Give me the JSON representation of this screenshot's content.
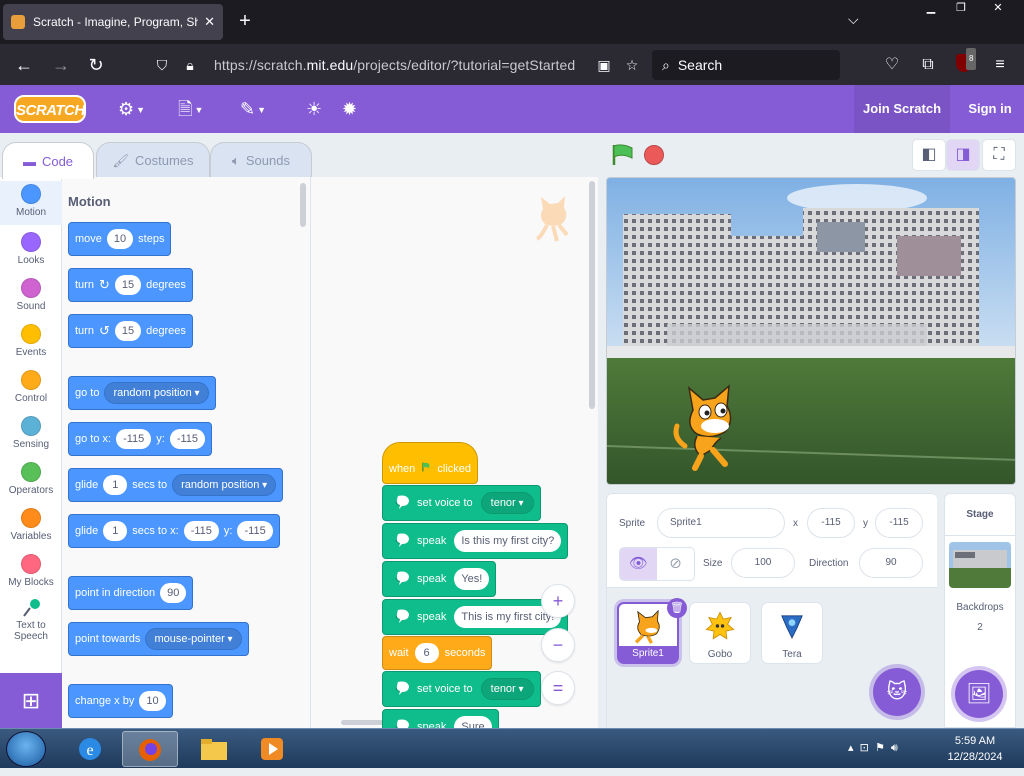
{
  "browser": {
    "tab_title": "Scratch - Imagine, Program, Sh",
    "new_tab": "+",
    "url_prefix": "https://scratch.",
    "url_host": "mit.edu",
    "url_rest": "/projects/editor/?tutorial=getStarted",
    "search_placeholder": "Search",
    "ublock_count": "8"
  },
  "menubar": {
    "logo": "SCRATCH",
    "join": "Join Scratch",
    "signin": "Sign in"
  },
  "editor_tabs": {
    "code": "Code",
    "costumes": "Costumes",
    "sounds": "Sounds"
  },
  "categories": [
    {
      "label": "Motion",
      "color": "#4c97ff"
    },
    {
      "label": "Looks",
      "color": "#9966ff"
    },
    {
      "label": "Sound",
      "color": "#cf63cf"
    },
    {
      "label": "Events",
      "color": "#ffbf00"
    },
    {
      "label": "Control",
      "color": "#ffab19"
    },
    {
      "label": "Sensing",
      "color": "#5cb1d6"
    },
    {
      "label": "Operators",
      "color": "#59c059"
    },
    {
      "label": "Variables",
      "color": "#ff8c1a"
    },
    {
      "label": "My Blocks",
      "color": "#ff6680"
    },
    {
      "label1": "Text to",
      "label2": "Speech",
      "color": "#0fbd8c"
    }
  ],
  "palette": {
    "title": "Motion",
    "move": {
      "a": "move",
      "n": "10",
      "b": "steps"
    },
    "turn_right": {
      "a": "turn",
      "n": "15",
      "b": "degrees"
    },
    "turn_left": {
      "a": "turn",
      "n": "15",
      "b": "degrees"
    },
    "goto": {
      "a": "go to",
      "dd": "random position"
    },
    "goto_xy": {
      "a": "go to x:",
      "x": "-115",
      "b": "y:",
      "y": "-115"
    },
    "glide": {
      "a": "glide",
      "n": "1",
      "b": "secs to",
      "dd": "random position"
    },
    "glide_xy": {
      "a": "glide",
      "n": "1",
      "b": "secs to x:",
      "x": "-115",
      "c": "y:",
      "y": "-115"
    },
    "point_dir": {
      "a": "point in direction",
      "n": "90"
    },
    "point_towards": {
      "a": "point towards",
      "dd": "mouse-pointer"
    },
    "change_x": {
      "a": "change x by",
      "n": "10"
    }
  },
  "script": {
    "hat": {
      "a": "when",
      "b": "clicked"
    },
    "b1": {
      "a": "set voice to",
      "dd": "tenor"
    },
    "b2": {
      "a": "speak",
      "t": "Is this my first city?"
    },
    "b3": {
      "a": "speak",
      "t": "Yes!"
    },
    "b4": {
      "a": "speak",
      "t": "This is my first city!"
    },
    "wait": {
      "a": "wait",
      "n": "6",
      "b": "seconds"
    },
    "b5": {
      "a": "set voice to",
      "dd": "tenor"
    },
    "b6": {
      "a": "speak",
      "t": "Sure"
    }
  },
  "zoom": {
    "in": "+",
    "out": "−",
    "reset": "="
  },
  "sprite_info": {
    "sprite_label": "Sprite",
    "sprite_name": "Sprite1",
    "x_label": "x",
    "x_value": "-115",
    "y_label": "y",
    "y_value": "-115",
    "show_label": "Show",
    "size_label": "Size",
    "size_value": "100",
    "direction_label": "Direction",
    "direction_value": "90"
  },
  "sprites": [
    {
      "name": "Sprite1",
      "selected": true
    },
    {
      "name": "Gobo",
      "selected": false
    },
    {
      "name": "Tera",
      "selected": false
    }
  ],
  "stage_pane": {
    "title": "Stage",
    "backdrops_label": "Backdrops",
    "backdrops_count": "2"
  },
  "taskbar": {
    "time": "5:59 AM",
    "date": "12/28/2024"
  }
}
